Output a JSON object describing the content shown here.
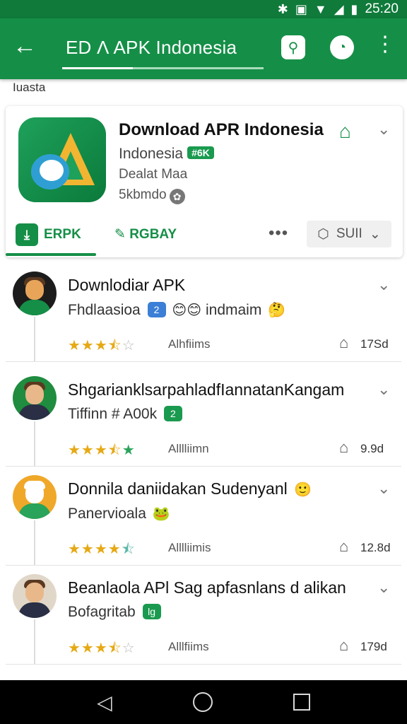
{
  "status_bar": {
    "time": "25:20",
    "icons": [
      "bluetooth-icon",
      "vibrate-icon",
      "wifi-icon",
      "signal-icon",
      "battery-icon"
    ]
  },
  "app_bar": {
    "title": "ED Λ APK Indonesia",
    "back_icon": "arrow-left-icon",
    "search_icon": "search-icon",
    "timer_icon": "timer-icon",
    "more_icon": "more-vertical-icon"
  },
  "section_label": "Iuasta",
  "header_card": {
    "app_name": "Download APR Indonesia",
    "subtitle": "Indonesia",
    "badge": "#6K",
    "meta1": "Dealat Maa",
    "meta2": "5kbmdo",
    "home_icon": "home-icon",
    "chevron_icon": "chevron-down-icon",
    "actions": {
      "apk_label": "ERPK",
      "rgbay_label": "RGBAY",
      "dots": "•••",
      "sbu_label": "SUII"
    }
  },
  "list": [
    {
      "title": "Downlodiar APK",
      "subtitle": "Fhdlaasioa",
      "tail": "indmaim",
      "chip": "2",
      "chip_color": "#3b7fd6",
      "rating": 3.5,
      "rating_text": "Alhfiims",
      "count": "17Sd",
      "avatar_bg": "#1c1c1c",
      "avatar_ring": "#158f47"
    },
    {
      "title": "ShgarianklsarpahladfIannatanKangam",
      "subtitle": "Tiffinn # A00k",
      "tail": "",
      "chip": "2",
      "chip_color": "#1a9a4f",
      "rating": 3.5,
      "rating_text": "Alllliimn",
      "count": "9.9d",
      "avatar_bg": "#1f8c3f",
      "avatar_ring": "#1f8c3f"
    },
    {
      "title": "Donnila daniidakan Sudenyanl",
      "subtitle": "Panervioala",
      "tail": "",
      "chip": "",
      "chip_color": "#1a9a4f",
      "rating": 4.5,
      "rating_text": "Alllliimis",
      "count": "12.8d",
      "avatar_bg": "#f0a82a",
      "avatar_ring": "#f0a82a"
    },
    {
      "title": "Beanlaola APl Sag apfasnlans d alikan",
      "subtitle": "Bofagritab",
      "tail": "",
      "chip": "lg",
      "chip_color": "#1a9a4f",
      "rating": 3.5,
      "rating_text": "Alllfiims",
      "count": "179d",
      "avatar_bg": "#e0d7c8",
      "avatar_ring": "#c7b59b"
    }
  ],
  "nav": {
    "back": "nav-back-icon",
    "home": "nav-home-icon",
    "recent": "nav-recent-icon"
  }
}
